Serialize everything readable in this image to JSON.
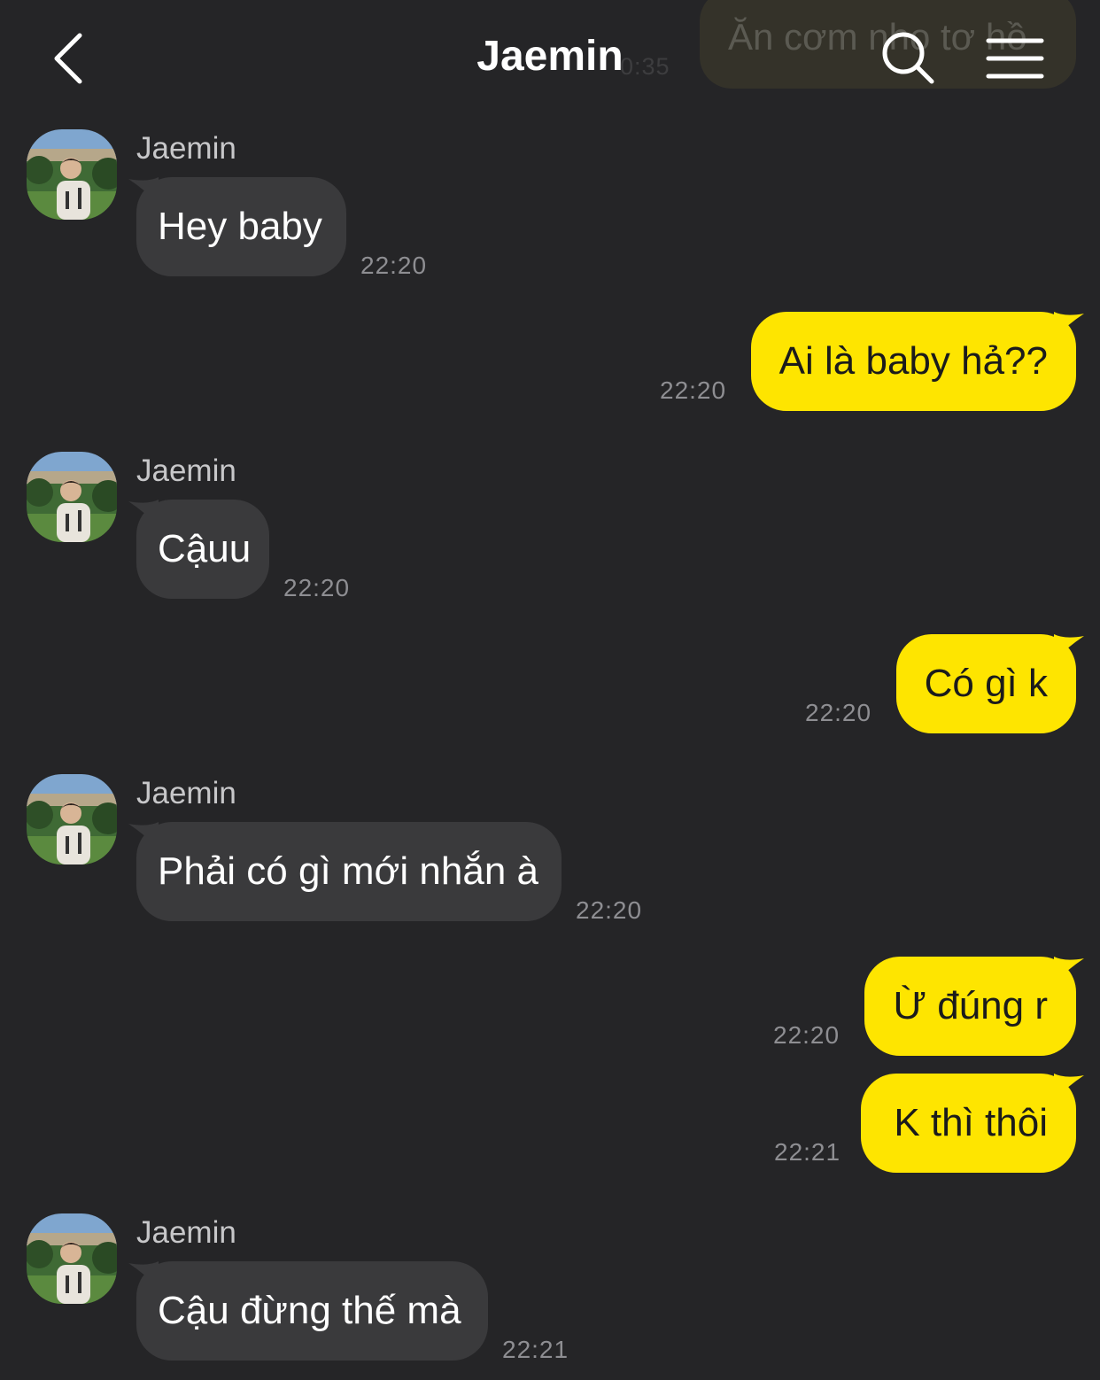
{
  "header": {
    "title": "Jaemin",
    "back_icon": "chevron-left-icon",
    "search_icon": "search-icon",
    "menu_icon": "menu-icon",
    "notice_preview": "Ăn cơm nho tơ hồ",
    "notice_time": "0:35"
  },
  "colors": {
    "background": "#252527",
    "incoming_bubble": "#3a3a3c",
    "outgoing_bubble": "#fee500",
    "timestamp": "#8e8e92"
  },
  "messages": [
    {
      "direction": "in",
      "sender": "Jaemin",
      "text": "Hey baby",
      "time": "22:20"
    },
    {
      "direction": "out",
      "text": "Ai là baby hả??",
      "time": "22:20"
    },
    {
      "direction": "in",
      "sender": "Jaemin",
      "text": "Cậuu",
      "time": "22:20"
    },
    {
      "direction": "out",
      "text": "Có gì k",
      "time": "22:20"
    },
    {
      "direction": "in",
      "sender": "Jaemin",
      "text": "Phải có gì mới nhắn à",
      "time": "22:20"
    },
    {
      "direction": "out",
      "text": "Ừ đúng r",
      "time": "22:20"
    },
    {
      "direction": "out",
      "text": "K thì thôi",
      "time": "22:21"
    },
    {
      "direction": "in",
      "sender": "Jaemin",
      "text": "Cậu đừng thế mà",
      "time": "22:21"
    }
  ]
}
